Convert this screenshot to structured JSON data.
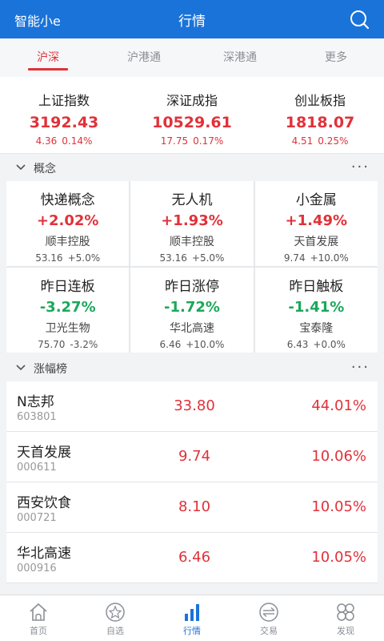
{
  "header": {
    "app_name": "智能小e",
    "title": "行情",
    "search_icon": "search-icon"
  },
  "tabs": [
    {
      "label": "沪深",
      "active": true
    },
    {
      "label": "沪港通"
    },
    {
      "label": "深港通"
    },
    {
      "label": "更多"
    }
  ],
  "indices": [
    {
      "name": "上证指数",
      "value": "3192.43",
      "change": "4.36",
      "pct": "0.14%"
    },
    {
      "name": "深证成指",
      "value": "10529.61",
      "change": "17.75",
      "pct": "0.17%"
    },
    {
      "name": "创业板指",
      "value": "1818.07",
      "change": "4.51",
      "pct": "0.25%"
    }
  ],
  "concept_section": {
    "title": "概念",
    "more": "···"
  },
  "concepts": [
    {
      "name": "快递概念",
      "pct": "+2.02%",
      "trend": "up",
      "stock": "顺丰控股",
      "price": "53.16",
      "stock_pct": "+5.0%"
    },
    {
      "name": "无人机",
      "pct": "+1.93%",
      "trend": "up",
      "stock": "顺丰控股",
      "price": "53.16",
      "stock_pct": "+5.0%"
    },
    {
      "name": "小金属",
      "pct": "+1.49%",
      "trend": "up",
      "stock": "天首发展",
      "price": "9.74",
      "stock_pct": "+10.0%"
    },
    {
      "name": "昨日连板",
      "pct": "-3.27%",
      "trend": "down",
      "stock": "卫光生物",
      "price": "75.70",
      "stock_pct": "-3.2%"
    },
    {
      "name": "昨日涨停",
      "pct": "-1.72%",
      "trend": "down",
      "stock": "华北高速",
      "price": "6.46",
      "stock_pct": "+10.0%"
    },
    {
      "name": "昨日触板",
      "pct": "-1.41%",
      "trend": "down",
      "stock": "宝泰隆",
      "price": "6.43",
      "stock_pct": "+0.0%"
    }
  ],
  "gainers_section": {
    "title": "涨幅榜",
    "more": "···"
  },
  "gainers": [
    {
      "name": "N志邦",
      "code": "603801",
      "price": "33.80",
      "pct": "44.01%"
    },
    {
      "name": "天首发展",
      "code": "000611",
      "price": "9.74",
      "pct": "10.06%"
    },
    {
      "name": "西安饮食",
      "code": "000721",
      "price": "8.10",
      "pct": "10.05%"
    },
    {
      "name": "华北高速",
      "code": "000916",
      "price": "6.46",
      "pct": "10.05%"
    }
  ],
  "bottom_nav": [
    {
      "label": "首页",
      "icon": "home-icon"
    },
    {
      "label": "自选",
      "icon": "star-icon"
    },
    {
      "label": "行情",
      "icon": "bar-chart-icon",
      "active": true
    },
    {
      "label": "交易",
      "icon": "exchange-icon"
    },
    {
      "label": "发现",
      "icon": "discover-icon"
    }
  ],
  "colors": {
    "brand": "#1a73d9",
    "up": "#e0323a",
    "down": "#1aa85a"
  }
}
